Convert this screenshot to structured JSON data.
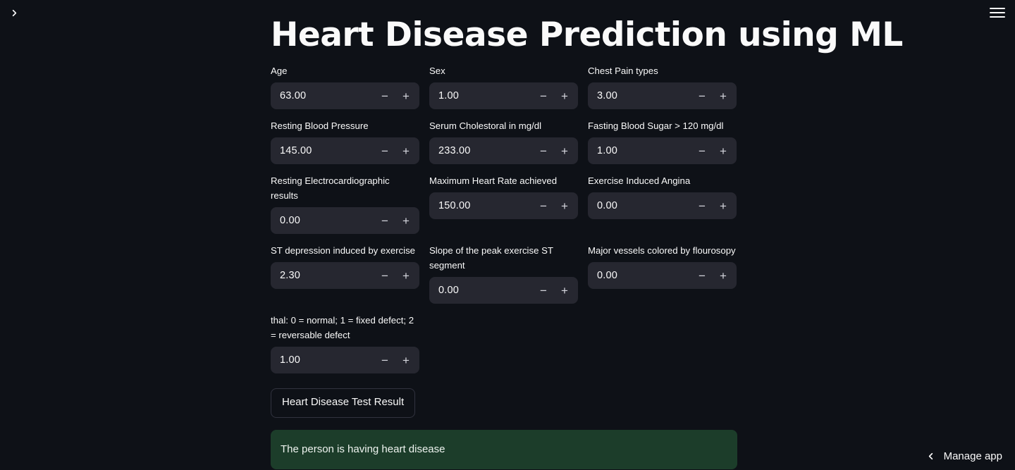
{
  "app": {
    "title": "Heart Disease Prediction using ML",
    "background_color": "#0e1117",
    "input_background_color": "#262730",
    "success_color": "#1c3d2a",
    "text_color": "#fafafa"
  },
  "chrome": {
    "sidebar_toggle_icon": "chevron-right-icon",
    "menu_icon": "hamburger-menu-icon",
    "manage_app_label": "Manage app",
    "manage_app_icon": "chevron-left-icon"
  },
  "stepper": {
    "decrement_label": "−",
    "increment_label": "+"
  },
  "fields": [
    {
      "label": "Age",
      "value": "63.00"
    },
    {
      "label": "Sex",
      "value": "1.00"
    },
    {
      "label": "Chest Pain types",
      "value": "3.00"
    },
    {
      "label": "Resting Blood Pressure",
      "value": "145.00"
    },
    {
      "label": "Serum Cholestoral in mg/dl",
      "value": "233.00"
    },
    {
      "label": "Fasting Blood Sugar > 120 mg/dl",
      "value": "1.00"
    },
    {
      "label": "Resting Electrocardiographic results",
      "value": "0.00"
    },
    {
      "label": "Maximum Heart Rate achieved",
      "value": "150.00"
    },
    {
      "label": "Exercise Induced Angina",
      "value": "0.00"
    },
    {
      "label": "ST depression induced by exercise",
      "value": "2.30"
    },
    {
      "label": "Slope of the peak exercise ST segment",
      "value": "0.00"
    },
    {
      "label": "Major vessels colored by flourosopy",
      "value": "0.00"
    },
    {
      "label": "thal: 0 = normal; 1 = fixed defect; 2 = reversable defect",
      "value": "1.00"
    }
  ],
  "action": {
    "predict_button_label": "Heart Disease Test Result"
  },
  "result": {
    "message": "The person is having heart disease"
  }
}
